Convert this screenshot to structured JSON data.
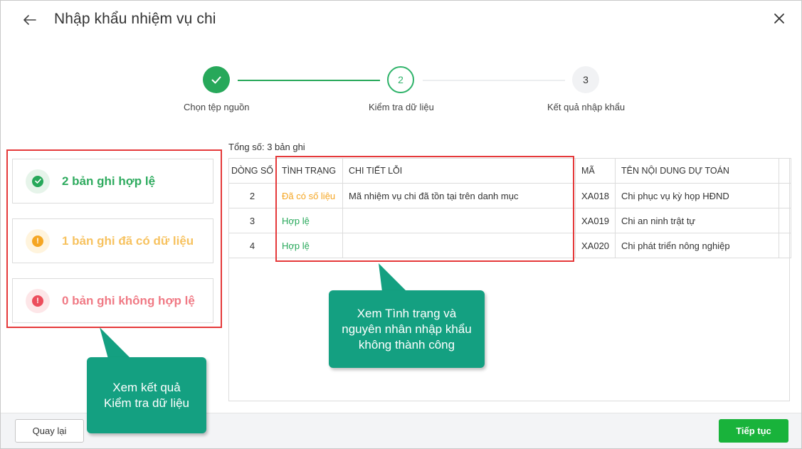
{
  "header": {
    "title": "Nhập khẩu nhiệm vụ chi"
  },
  "stepper": {
    "steps": [
      {
        "number": "1",
        "label": "Chọn tệp nguồn",
        "state": "done"
      },
      {
        "number": "2",
        "label": "Kiểm tra dữ liệu",
        "state": "active"
      },
      {
        "number": "3",
        "label": "Kết quả nhập khẩu",
        "state": "pending"
      }
    ]
  },
  "summary": {
    "valid": "2 bản ghi hợp lệ",
    "existing": "1 bản ghi đã có dữ liệu",
    "invalid": "0 bản ghi không hợp lệ"
  },
  "table": {
    "total_text": "Tổng số: 3 bản ghi",
    "columns": [
      "DÒNG SỐ",
      "TÌNH TRẠNG",
      "CHI TIẾT LỖI",
      "MÃ",
      "TÊN NỘI DUNG DỰ TOÁN"
    ],
    "rows": [
      {
        "line": "2",
        "status": "Đã có số liệu",
        "detail": "Mã nhiệm vụ chi đã tồn tại trên danh mục",
        "code": "XA018",
        "name": "Chi phục vụ kỳ họp HĐND"
      },
      {
        "line": "3",
        "status": "Hợp lệ",
        "detail": "",
        "code": "XA019",
        "name": "Chi an ninh trật tự"
      },
      {
        "line": "4",
        "status": "Hợp lệ",
        "detail": "",
        "code": "XA020",
        "name": "Chi phát triển nông nghiệp"
      }
    ]
  },
  "callouts": {
    "right": [
      "Xem Tình trạng và",
      "nguyên nhân nhập khẩu",
      "không thành công"
    ],
    "left": [
      "Xem kết quả",
      "Kiểm tra dữ liệu"
    ]
  },
  "footer": {
    "back_label": "Quay lại",
    "next_label": "Tiếp tục"
  },
  "colors": {
    "green": "#27a85a",
    "warning": "#f5a623",
    "error": "#ec4d5c",
    "callout": "#14a081",
    "highlight": "#e5393a",
    "primary_button": "#19b33b"
  }
}
